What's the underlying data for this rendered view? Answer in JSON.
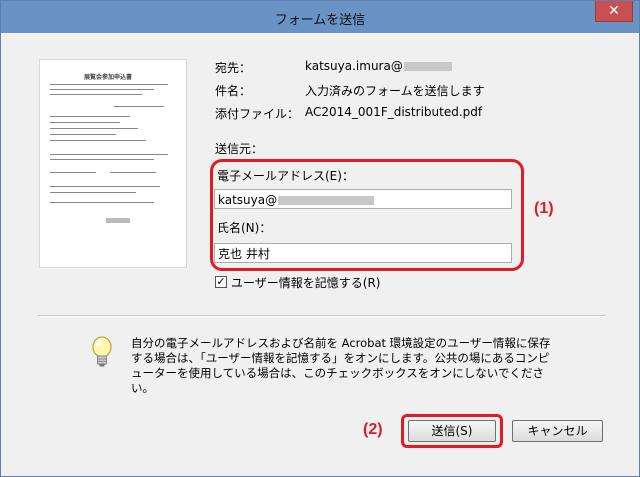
{
  "window": {
    "title": "フォームを送信",
    "close_glyph": "✕"
  },
  "thumbnail": {
    "doc_title": "展覧会参加申込書"
  },
  "fields": {
    "to_label": "宛先：",
    "to_value": "katsuya.imura@",
    "subject_label": "件名：",
    "subject_value": "入力済みのフォームを送信します",
    "attachment_label": "添付ファイル：",
    "attachment_value": "AC2014_001F_distributed.pdf"
  },
  "sender": {
    "section_label": "送信元：",
    "email_label": "電子メールアドレス(E)：",
    "email_value": "katsuya@",
    "name_label": "氏名(N)：",
    "name_value": "克也 井村"
  },
  "remember": {
    "label": "ユーザー情報を記憶する(R)",
    "checked": true,
    "check_glyph": "✓"
  },
  "info": {
    "icon": "lightbulb-icon",
    "text": "自分の電子メールアドレスおよび名前を Acrobat 環境設定のユーザー情報に保存する場合は、「ユーザー情報を記憶する」をオンにします。公共の場にあるコンピューターを使用している場合は、このチェックボックスをオンにしないでください。"
  },
  "buttons": {
    "send": "送信(S)",
    "cancel": "キャンセル"
  },
  "annotations": {
    "marker1": "(1)",
    "marker2": "(2)",
    "color": "#e01b24"
  }
}
